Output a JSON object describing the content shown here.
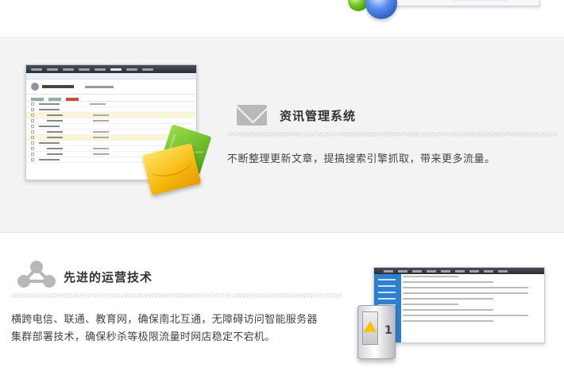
{
  "sections": {
    "info_management": {
      "title": "资讯管理系统",
      "description": "不断整理更新文章，提搞搜索引擎抓取，带来更多流量。",
      "icon": "envelope-icon"
    },
    "tech": {
      "title": "先进的运营技术",
      "description_line1": "横跨电信、联通、教育网，确保南北互通，无障碍访问智能服务器",
      "description_line2": "集群部署技术，确保秒杀等极限流量时网店稳定不宕机。",
      "icon": "network-icon"
    }
  },
  "colors": {
    "title": "#333333",
    "text": "#444444",
    "section_bg": "#f3f3f3",
    "accent_blue": "#2f7fd1"
  }
}
